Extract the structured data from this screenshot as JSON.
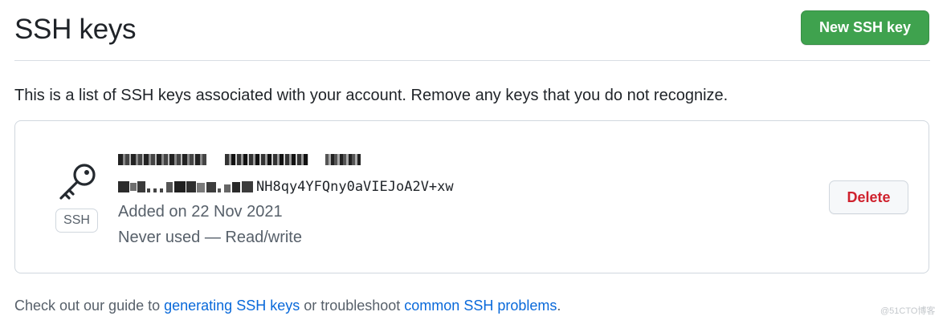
{
  "header": {
    "title": "SSH keys",
    "new_key_label": "New SSH key"
  },
  "intro": "This is a list of SSH keys associated with your account. Remove any keys that you do not recognize.",
  "key": {
    "type_badge": "SSH",
    "title_redacted": true,
    "fingerprint_visible_suffix": "NH8qy4YFQny0aVIEJoA2V+xw",
    "added": "Added on 22 Nov 2021",
    "usage": "Never used — Read/write",
    "delete_label": "Delete"
  },
  "footer": {
    "prefix": "Check out our guide to ",
    "link1": "generating SSH keys",
    "middle": " or troubleshoot ",
    "link2": "common SSH problems",
    "suffix": "."
  },
  "watermark": "@51CTO博客",
  "colors": {
    "primary_button": "#3fa24e",
    "danger_text": "#cf222e",
    "link": "#0969da",
    "muted_text": "#57606a",
    "border": "#d0d7de"
  },
  "icons": {
    "key_icon": "key-icon"
  }
}
